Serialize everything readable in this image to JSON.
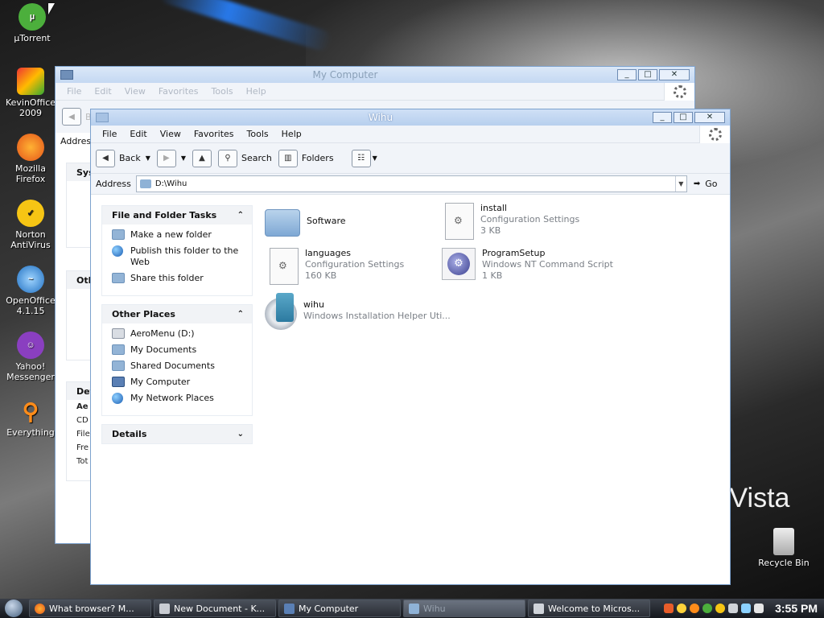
{
  "desktop": {
    "icons": [
      {
        "label": "µTorrent"
      },
      {
        "label": "KevinOffice 2009"
      },
      {
        "label": "Mozilla Firefox"
      },
      {
        "label": "Norton AntiVirus"
      },
      {
        "label": "OpenOffice 4.1.15"
      },
      {
        "label": "Yahoo! Messenger"
      },
      {
        "label": "Everything"
      },
      {
        "label": "Recycle Bin"
      }
    ],
    "wallpaper_text": "s Vista"
  },
  "bg_window": {
    "title": "My Computer",
    "menu": [
      "File",
      "Edit",
      "View",
      "Favorites",
      "Tools",
      "Help"
    ],
    "address_label": "Addres",
    "side_heads": [
      "Sys",
      "Oth",
      "Det"
    ],
    "side_rows": [
      "Ae",
      "CD",
      "File",
      "Fre",
      "Tot"
    ],
    "back_stub": "B"
  },
  "window": {
    "title": "Wihu",
    "controls": {
      "minimize": "_",
      "maximize": "□",
      "close": "✕"
    },
    "menu": [
      "File",
      "Edit",
      "View",
      "Favorites",
      "Tools",
      "Help"
    ],
    "toolbar": {
      "back": "Back",
      "search": "Search",
      "folders": "Folders"
    },
    "address": {
      "label": "Address",
      "value": "D:\\Wihu",
      "go": "Go"
    },
    "panels": {
      "tasks": {
        "title": "File and Folder Tasks",
        "items": [
          "Make a new folder",
          "Publish this folder to the Web",
          "Share this folder"
        ]
      },
      "other": {
        "title": "Other Places",
        "items": [
          "AeroMenu (D:)",
          "My Documents",
          "Shared Documents",
          "My Computer",
          "My Network Places"
        ]
      },
      "details": {
        "title": "Details"
      }
    },
    "files": [
      {
        "name": "Software",
        "type": "",
        "size": ""
      },
      {
        "name": "install",
        "type": "Configuration Settings",
        "size": "3 KB"
      },
      {
        "name": "languages",
        "type": "Configuration Settings",
        "size": "160 KB"
      },
      {
        "name": "ProgramSetup",
        "type": "Windows NT Command Script",
        "size": "1 KB"
      },
      {
        "name": "wihu",
        "type": "Windows Installation Helper Uti...",
        "size": ""
      }
    ]
  },
  "taskbar": {
    "items": [
      {
        "label": "What browser? M..."
      },
      {
        "label": "New Document - K..."
      },
      {
        "label": "My Computer"
      },
      {
        "label": "Wihu"
      },
      {
        "label": "Welcome to Micros..."
      }
    ],
    "clock": "3:55 PM"
  },
  "colors": {
    "title_active": "#b7cfee",
    "accent": "#7da2ce",
    "taskbar": "#15181d"
  }
}
